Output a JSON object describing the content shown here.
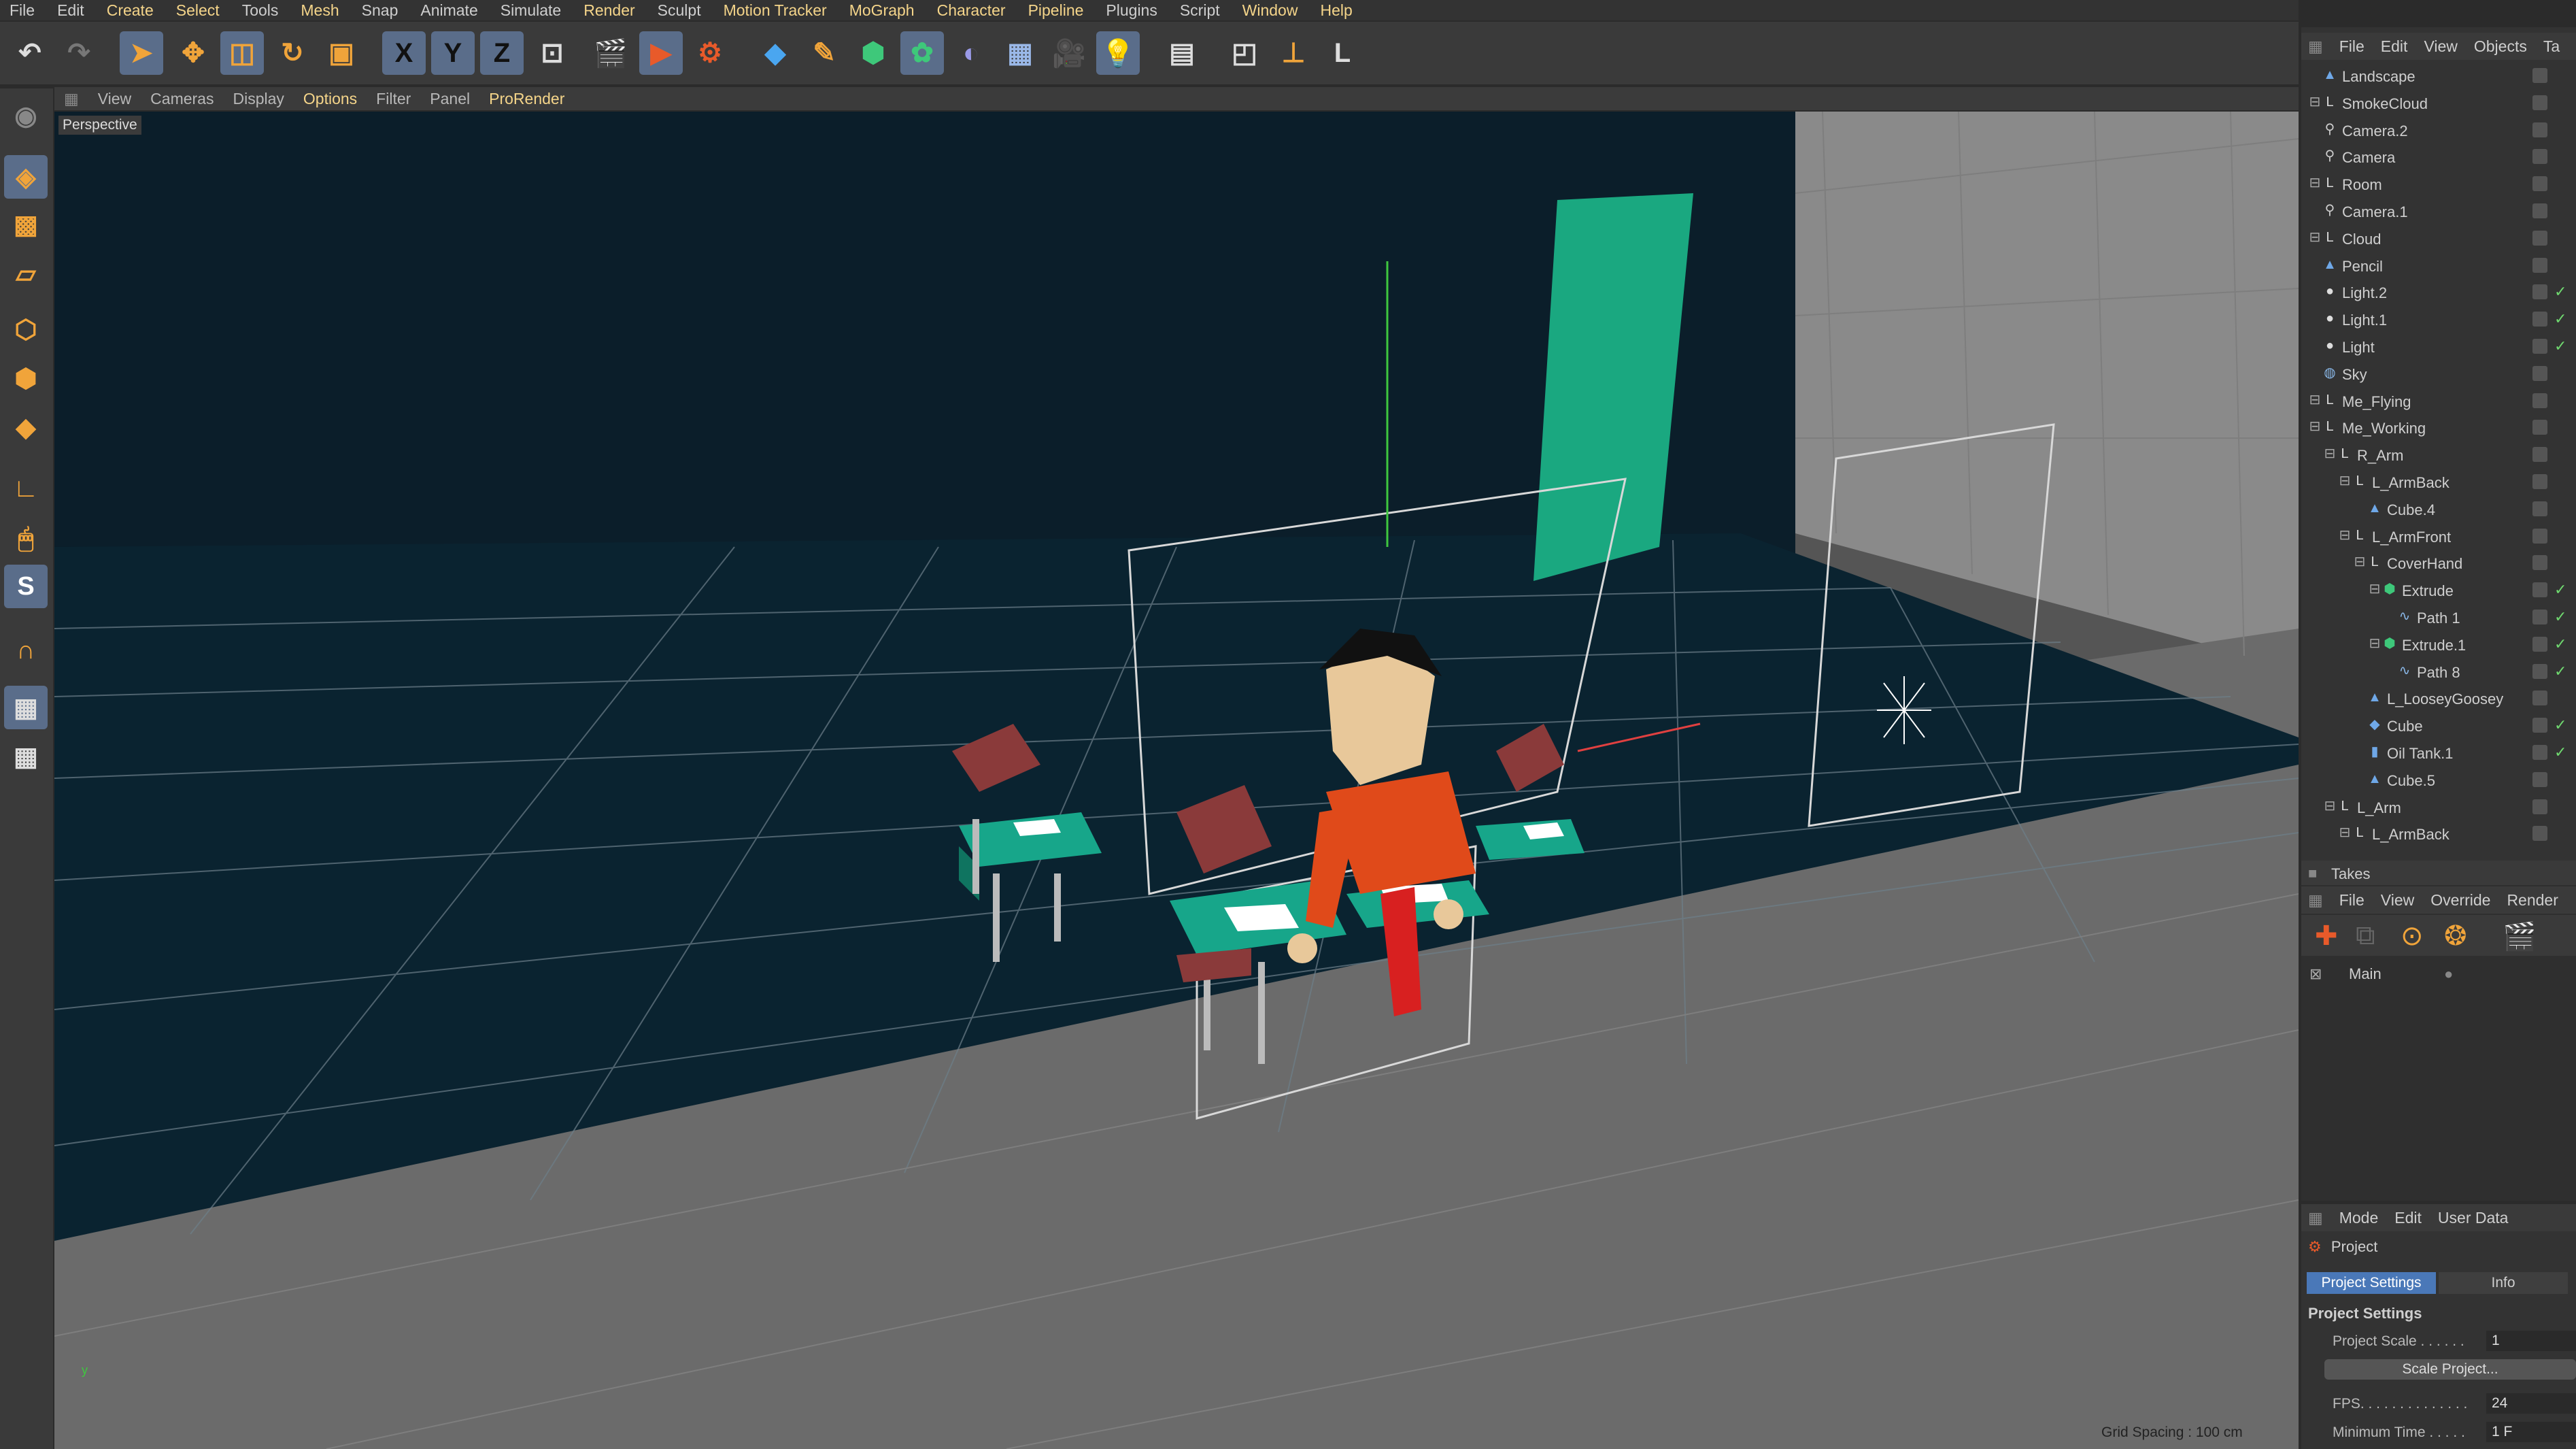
{
  "menu": [
    "File",
    "Edit",
    "Create",
    "Select",
    "Tools",
    "Mesh",
    "Snap",
    "Animate",
    "Simulate",
    "Render",
    "Sculpt",
    "Motion Tracker",
    "MoGraph",
    "Character",
    "Pipeline",
    "Plugins",
    "Script",
    "Window",
    "Help"
  ],
  "menu_highlighted": [
    "Create",
    "Select",
    "Mesh",
    "Render",
    "Motion Tracker",
    "MoGraph",
    "Character",
    "Pipeline",
    "Window",
    "Help"
  ],
  "toolbar": {
    "icons": [
      "undo-icon",
      "redo-icon",
      "select-icon",
      "move-icon",
      "scale-icon",
      "rotate-icon",
      "recent-tool-icon",
      "x-axis-icon",
      "y-axis-icon",
      "z-axis-icon",
      "coord-system-icon",
      "render-view-icon",
      "render-picture-viewer-icon",
      "render-settings-icon",
      "cube-primitive-icon",
      "pen-spline-icon",
      "subdivision-icon",
      "cloner-icon",
      "deformer-icon",
      "floor-icon",
      "camera-icon",
      "light-icon",
      "irr-icon",
      "workplane-icon",
      "axis-snap-icon",
      "lock-icon"
    ],
    "axis_labels": [
      "X",
      "Y",
      "Z"
    ]
  },
  "viewport": {
    "menu": [
      "View",
      "Cameras",
      "Display",
      "Options",
      "Filter",
      "Panel",
      "ProRender"
    ],
    "highlighted": [
      "Options",
      "ProRender"
    ],
    "camera_label": "Perspective",
    "grid_spacing": "Grid Spacing : 100 cm"
  },
  "object_manager": {
    "menu": [
      "File",
      "Edit",
      "View",
      "Objects",
      "Ta"
    ],
    "objects": [
      {
        "name": "Landscape",
        "icon": "landscape-icon",
        "depth": 0,
        "expand": false,
        "check": false
      },
      {
        "name": "SmokeCloud",
        "icon": "null-icon",
        "depth": 0,
        "expand": true,
        "check": false
      },
      {
        "name": "Camera.2",
        "icon": "camera-icon",
        "depth": 0,
        "expand": false,
        "check": false
      },
      {
        "name": "Camera",
        "icon": "camera-icon",
        "depth": 0,
        "expand": false,
        "check": false
      },
      {
        "name": "Room",
        "icon": "null-icon",
        "depth": 0,
        "expand": true,
        "check": false
      },
      {
        "name": "Camera.1",
        "icon": "camera-icon",
        "depth": 0,
        "expand": false,
        "check": false
      },
      {
        "name": "Cloud",
        "icon": "null-icon",
        "depth": 0,
        "expand": true,
        "check": false
      },
      {
        "name": "Pencil",
        "icon": "polygon-icon",
        "depth": 0,
        "expand": false,
        "check": false
      },
      {
        "name": "Light.2",
        "icon": "light-icon",
        "depth": 0,
        "expand": false,
        "check": true
      },
      {
        "name": "Light.1",
        "icon": "light-icon",
        "depth": 0,
        "expand": false,
        "check": true
      },
      {
        "name": "Light",
        "icon": "light-icon",
        "depth": 0,
        "expand": false,
        "check": true
      },
      {
        "name": "Sky",
        "icon": "sky-icon",
        "depth": 0,
        "expand": false,
        "check": false
      },
      {
        "name": "Me_Flying",
        "icon": "null-icon",
        "depth": 0,
        "expand": true,
        "check": false
      },
      {
        "name": "Me_Working",
        "icon": "null-icon",
        "depth": 0,
        "expand": true,
        "check": false
      },
      {
        "name": "R_Arm",
        "icon": "null-icon",
        "depth": 1,
        "expand": true,
        "check": false
      },
      {
        "name": "L_ArmBack",
        "icon": "null-icon",
        "depth": 2,
        "expand": true,
        "check": false
      },
      {
        "name": "Cube.4",
        "icon": "polygon-icon",
        "depth": 3,
        "expand": false,
        "check": false
      },
      {
        "name": "L_ArmFront",
        "icon": "null-icon",
        "depth": 2,
        "expand": true,
        "check": false
      },
      {
        "name": "CoverHand",
        "icon": "null-icon",
        "depth": 3,
        "expand": true,
        "check": false
      },
      {
        "name": "Extrude",
        "icon": "extrude-icon",
        "depth": 4,
        "expand": true,
        "check": true
      },
      {
        "name": "Path 1",
        "icon": "spline-icon",
        "depth": 5,
        "expand": false,
        "check": true
      },
      {
        "name": "Extrude.1",
        "icon": "extrude-icon",
        "depth": 4,
        "expand": true,
        "check": true
      },
      {
        "name": "Path 8",
        "icon": "spline-icon",
        "depth": 5,
        "expand": false,
        "check": true
      },
      {
        "name": "L_LooseyGoosey",
        "icon": "polygon-icon",
        "depth": 3,
        "expand": false,
        "check": false
      },
      {
        "name": "Cube",
        "icon": "cube-icon",
        "depth": 3,
        "expand": false,
        "check": true
      },
      {
        "name": "Oil Tank.1",
        "icon": "oiltank-icon",
        "depth": 3,
        "expand": false,
        "check": true
      },
      {
        "name": "Cube.5",
        "icon": "polygon-icon",
        "depth": 3,
        "expand": false,
        "check": false
      },
      {
        "name": "L_Arm",
        "icon": "null-icon",
        "depth": 1,
        "expand": true,
        "check": false
      },
      {
        "name": "L_ArmBack",
        "icon": "null-icon",
        "depth": 2,
        "expand": true,
        "check": false
      }
    ]
  },
  "takes": {
    "title": "Takes",
    "menu": [
      "File",
      "View",
      "Override",
      "Render"
    ],
    "main_take": "Main"
  },
  "attributes": {
    "menu": [
      "Mode",
      "Edit",
      "User Data"
    ],
    "object": "Project",
    "tabs": [
      "Project Settings",
      "Info"
    ],
    "section": "Project Settings",
    "project_scale_label": "Project Scale . . . . . .",
    "project_scale_value": "1",
    "scale_button": "Scale Project...",
    "fps_label": "FPS. . . . . . . . . . . . . .",
    "fps_value": "24",
    "min_time_label": "Minimum Time . . . . .",
    "min_time_value": "1 F"
  },
  "colors": {
    "accent": "#f5d58a",
    "selected": "#5a6d8a",
    "check": "#6fd86f"
  }
}
